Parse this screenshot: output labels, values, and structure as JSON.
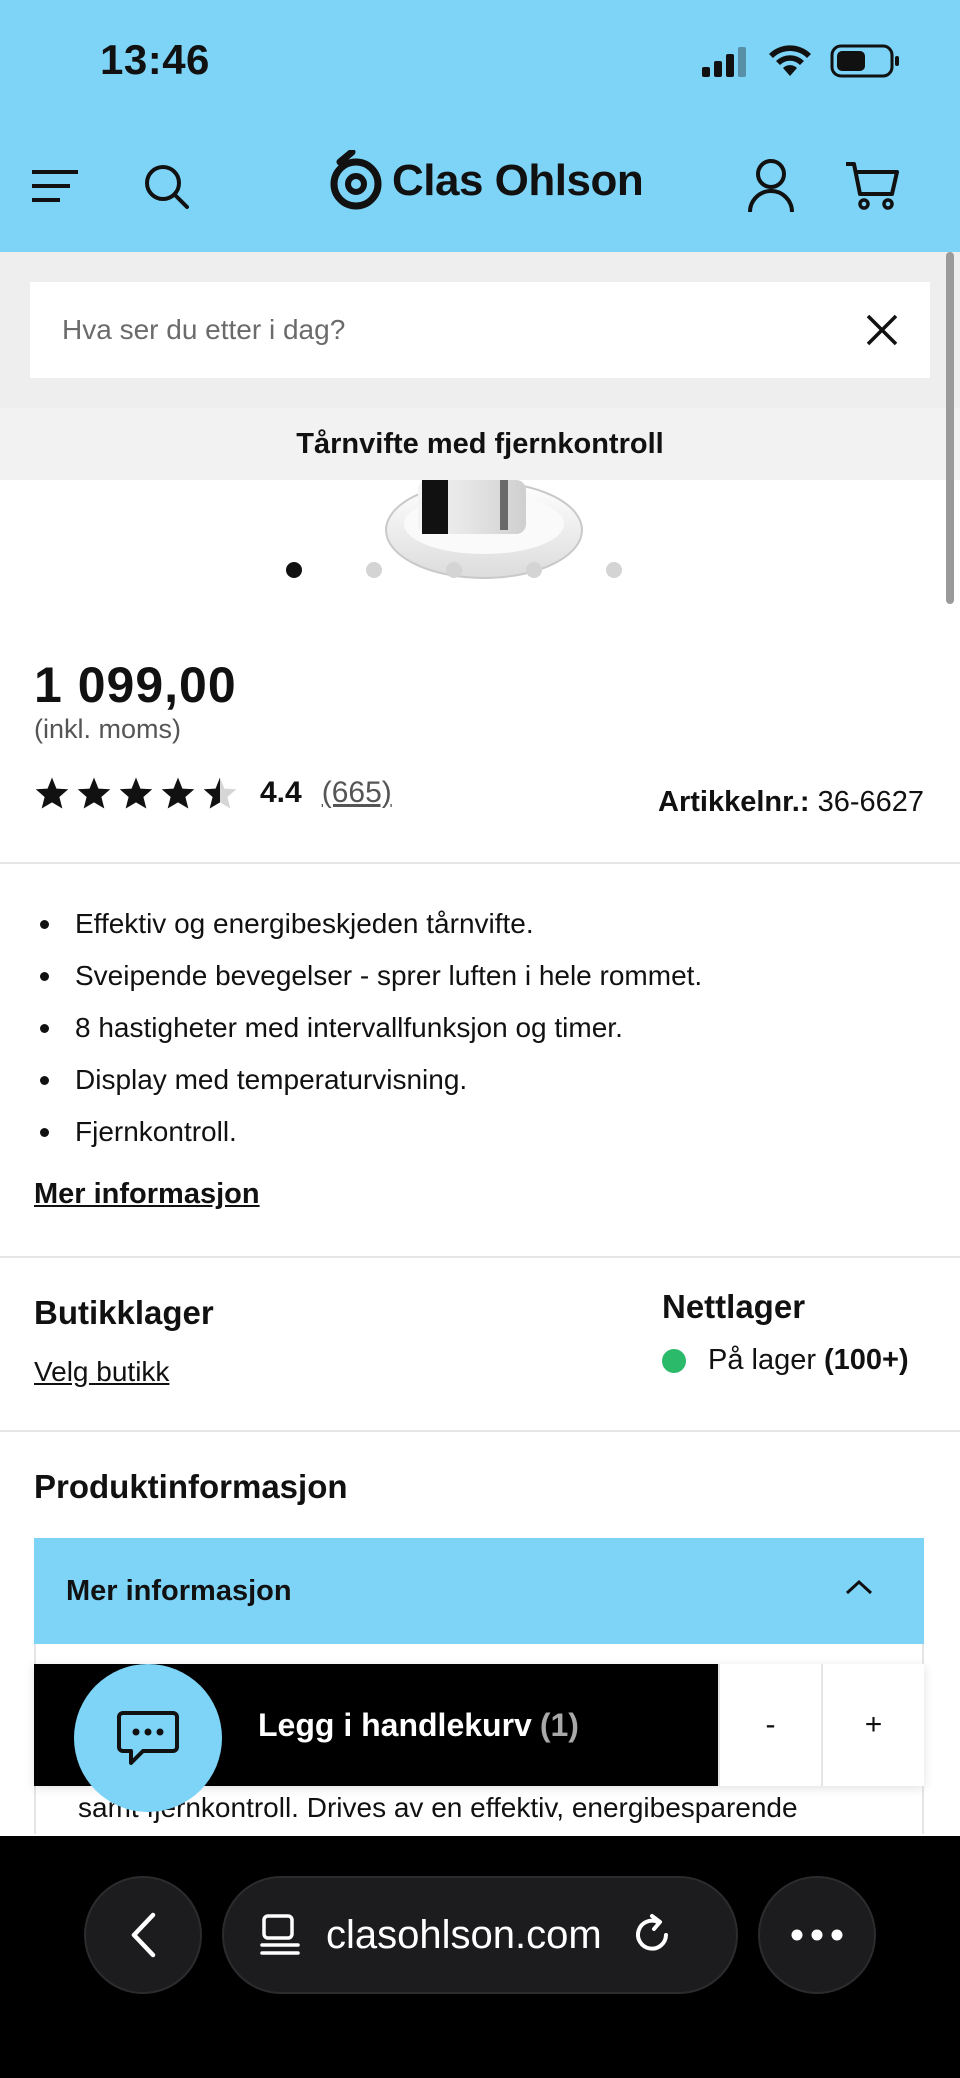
{
  "status_bar": {
    "time": "13:46"
  },
  "header": {
    "logo_text": "Clas Ohlson"
  },
  "search": {
    "placeholder": "Hva ser du etter i dag?"
  },
  "product": {
    "title": "Tårnvifte med fjernkontroll",
    "image_count": 5,
    "active_image": 1,
    "price": "1 099,00",
    "vat_note": "(inkl. moms)",
    "rating_value": "4.4",
    "rating_stars": 4.4,
    "rating_count": "(665)",
    "article_label": "Artikkelnr.:",
    "article_number": "36-6627"
  },
  "features": [
    "Effektiv og energibeskjeden tårnvifte.",
    "Sveipende bevegelser - sprer luften i hele rommet.",
    "8 hastigheter med intervallfunksjon og timer.",
    "Display med temperaturvisning.",
    "Fjernkontroll."
  ],
  "more_info_link": "Mer informasjon",
  "stock": {
    "store_title": "Butikklager",
    "store_link": "Velg butikk",
    "web_title": "Nettlager",
    "web_status": "På lager",
    "web_count": "(100+)",
    "web_status_color": "#2bb96a"
  },
  "product_info": {
    "title": "Produktinformasjon",
    "accordion_label": "Mer informasjon",
    "body_text": "samt fjernkontroll. Drives av en effektiv, energibesparende"
  },
  "cart": {
    "button_label": "Legg i handlekurv",
    "count": "(1)",
    "minus": "-",
    "plus": "+"
  },
  "browser": {
    "url": "clasohlson.com"
  },
  "colors": {
    "accent": "#7dd4f7"
  }
}
